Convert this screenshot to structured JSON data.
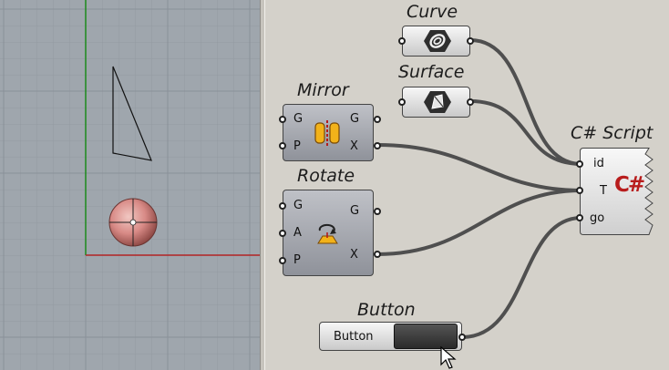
{
  "canvas": {
    "components": {
      "curve": {
        "title": "Curve"
      },
      "surface": {
        "title": "Surface"
      },
      "mirror": {
        "title": "Mirror",
        "inputs": [
          "G",
          "P"
        ],
        "outputs": [
          "G",
          "X"
        ]
      },
      "rotate": {
        "title": "Rotate",
        "inputs": [
          "G",
          "A",
          "P"
        ],
        "outputs": [
          "G",
          "X"
        ]
      },
      "csharp": {
        "title": "C# Script",
        "inputs": [
          "id",
          "T",
          "go"
        ],
        "badge": "C#"
      },
      "button": {
        "title": "Button",
        "label": "Button"
      }
    }
  },
  "colors": {
    "viewport_bg": "#9fa6ad",
    "canvas_bg": "#d4d1ca",
    "wire": "#4f4f4f",
    "axis_x": "#b22424",
    "axis_y": "#1d8a1d",
    "sphere": "#d88a86"
  },
  "icons": {
    "curve": "curve-param-icon",
    "surface": "surface-param-icon",
    "mirror": "mirror-icon",
    "rotate": "rotate-icon",
    "csharp": "csharp-icon",
    "cursor": "mouse-pointer-icon"
  }
}
